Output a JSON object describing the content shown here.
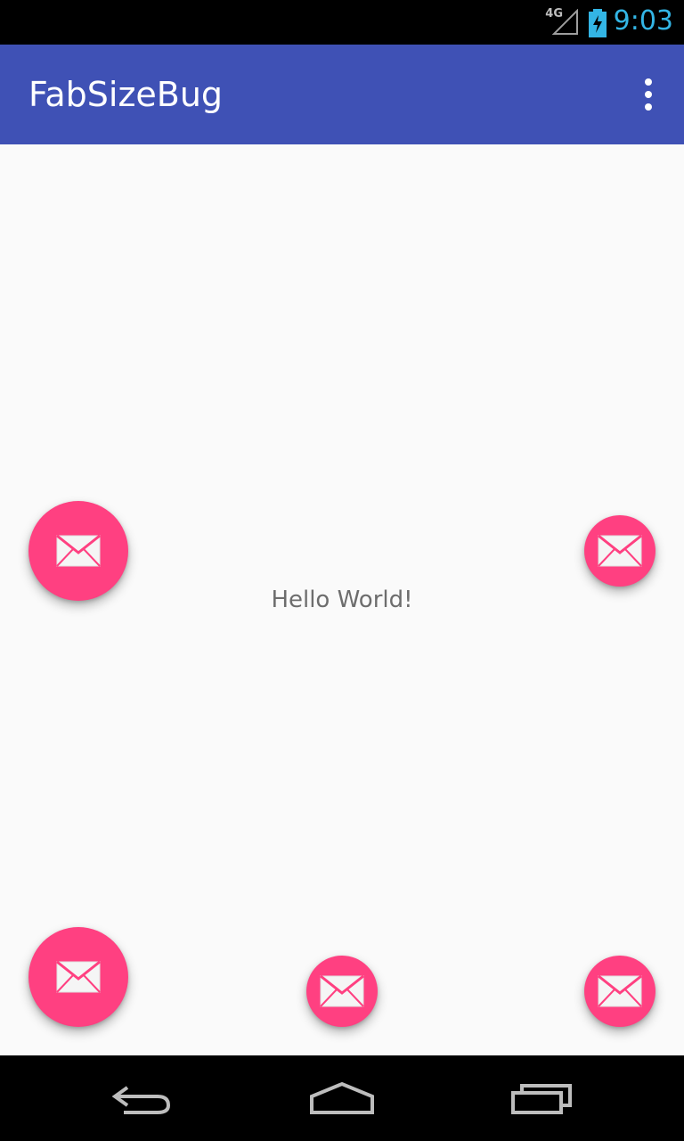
{
  "status_bar": {
    "network": "4G",
    "time": "9:03",
    "icons": [
      "signal-icon",
      "battery-charging-icon"
    ],
    "clock_color": "#33b5e5"
  },
  "app_bar": {
    "title": "FabSizeBug",
    "overflow_icon": "more-vert-icon",
    "color": "#3f51b5"
  },
  "content": {
    "message": "Hello World!",
    "fab_color": "#ff4081",
    "fab_icon": "mail-icon"
  },
  "nav_bar": {
    "icons": [
      "back-icon",
      "home-icon",
      "recents-icon"
    ]
  }
}
